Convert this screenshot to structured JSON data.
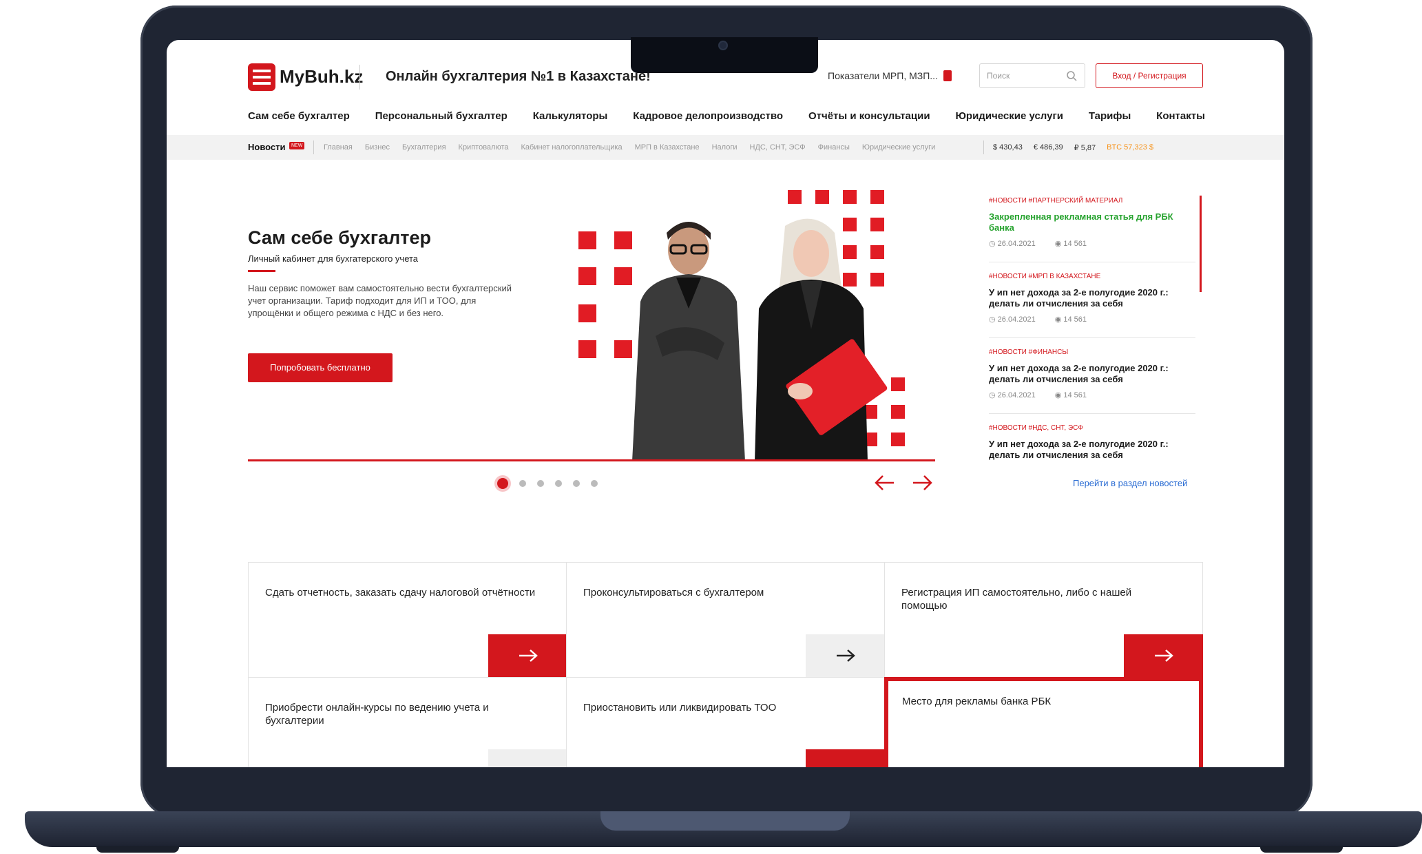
{
  "header": {
    "logo_text": "MyBuh.kz",
    "tagline": "Онлайн бухгалтерия №1 в Казахстане!",
    "mrp_link": "Показатели МРП, МЗП...",
    "search_placeholder": "Поиск",
    "login_label": "Вход / Регистрация"
  },
  "nav": {
    "items": [
      "Сам себе бухгалтер",
      "Персональный бухгалтер",
      "Калькуляторы",
      "Кадровое делопроизводство",
      "Отчёты и консультации",
      "Юридические услуги",
      "Тарифы",
      "Контакты"
    ]
  },
  "newsbar": {
    "title": "Новости",
    "badge": "NEW",
    "categories": [
      "Главная",
      "Бизнес",
      "Бухгалтерия",
      "Криптовалюта",
      "Кабинет налогоплательщика",
      "МРП в Казахстане",
      "Налоги",
      "НДС, СНТ, ЭСФ",
      "Финансы",
      "Юридические услуги"
    ],
    "rates": [
      "$ 430,43",
      "€ 486,39",
      "₽ 5,87",
      "BTC 57,323 $"
    ]
  },
  "hero": {
    "title": "Сам себе бухгалтер",
    "subtitle": "Личный кабинет для бухгатерского учета",
    "description": "Наш сервис поможет вам самостоятельно вести бухгалтерский учет организации. Тариф подходит для ИП и ТОО, для упрощёнки и общего режима с НДС и без него.",
    "button_label": "Попробовать бесплатно",
    "slides_count": 6,
    "active_slide": 1
  },
  "news": {
    "items": [
      {
        "tags": "#НОВОСТИ  #ПАРТНЕРСКИЙ МАТЕРИАЛ",
        "headline": "Закрепленная рекламная статья для РБК банка",
        "date": "26.04.2021",
        "views": "14 561"
      },
      {
        "tags": "#НОВОСТИ  #МРП В КАЗАХСТАНЕ",
        "headline": "У ип нет дохода за 2-е полугодие 2020 г.: делать ли отчисления за себя",
        "date": "26.04.2021",
        "views": "14 561"
      },
      {
        "tags": "#НОВОСТИ  #ФИНАНСЫ",
        "headline": "У ип нет дохода за 2-е полугодие 2020 г.: делать ли отчисления за себя",
        "date": "26.04.2021",
        "views": "14 561"
      },
      {
        "tags": "#НОВОСТИ  #НДС, СНТ, ЭСФ",
        "headline": "У ип нет дохода за 2-е полугодие 2020 г.: делать ли отчисления за себя"
      }
    ],
    "all_link": "Перейти в раздел новостей"
  },
  "cards": [
    {
      "text": "Сдать отчетность, заказать сдачу налоговой отчётности"
    },
    {
      "text": "Проконсультироваться с бухгалтером"
    },
    {
      "text": "Регистрация ИП самостоятельно, либо с нашей помощью"
    },
    {
      "text": "Приобрести онлайн-курсы по ведению учета и бухгалтерии"
    },
    {
      "text": "Приостановить или ликвидировать ТОО"
    },
    {
      "text": "Место для рекламы банка РБК"
    }
  ],
  "colors": {
    "brand_red": "#d3171d",
    "link_blue": "#2a6cd3",
    "pinned_green": "#27a32f",
    "btc_orange": "#f7931a",
    "frame": "#1f2533"
  }
}
